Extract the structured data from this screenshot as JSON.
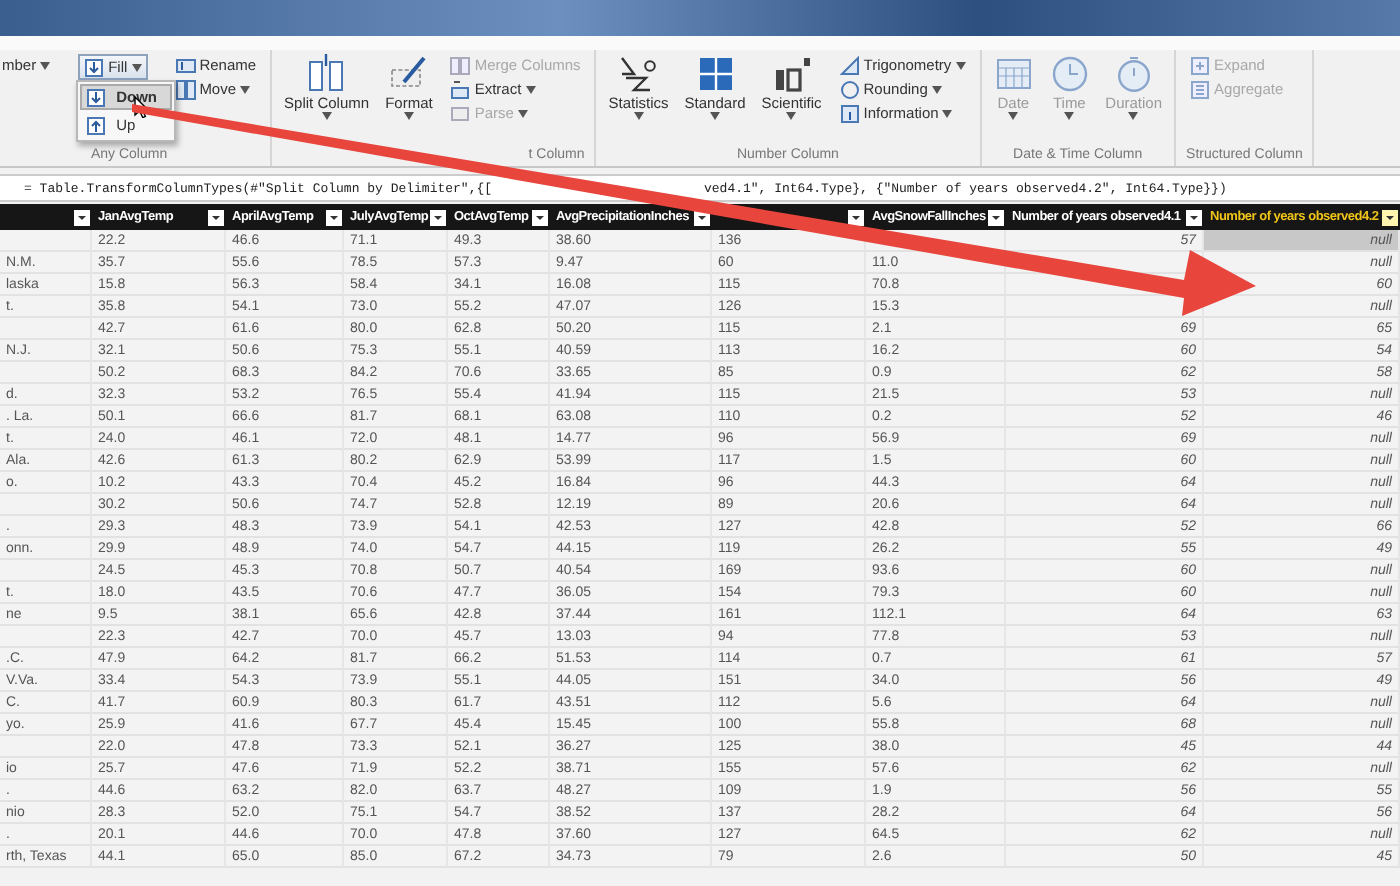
{
  "ribbon": {
    "groups": [
      {
        "label": "Any Column",
        "columns": [
          [
            {
              "kind": "small",
              "label": "mber",
              "dropdown": true,
              "disabled": false
            }
          ],
          [
            {
              "kind": "split",
              "label": "Fill",
              "dropdown": true,
              "disabled": false,
              "menu": [
                {
                  "label": "Down",
                  "selected": true
                },
                {
                  "label": "Up",
                  "selected": false
                }
              ]
            }
          ],
          [
            {
              "kind": "small",
              "label": "Rename",
              "dropdown": false,
              "disabled": false
            },
            {
              "kind": "small",
              "label": "Move",
              "dropdown": true,
              "disabled": false
            }
          ]
        ]
      },
      {
        "label": "t Column",
        "columns": [
          [
            {
              "kind": "large",
              "label": "Split Column",
              "dropdown": true,
              "disabled": false
            }
          ],
          [
            {
              "kind": "large",
              "label": "Format",
              "dropdown": true,
              "disabled": false
            }
          ],
          [
            {
              "kind": "small",
              "label": "Merge Columns",
              "dropdown": false,
              "disabled": true
            },
            {
              "kind": "small",
              "label": "Extract",
              "dropdown": true,
              "disabled": false
            },
            {
              "kind": "small",
              "label": "Parse",
              "dropdown": true,
              "disabled": true
            }
          ]
        ]
      },
      {
        "label": "Number Column",
        "columns": [
          [
            {
              "kind": "large",
              "label": "Statistics",
              "dropdown": true,
              "disabled": false
            }
          ],
          [
            {
              "kind": "large",
              "label": "Standard",
              "dropdown": true,
              "disabled": false
            }
          ],
          [
            {
              "kind": "large",
              "label": "Scientific",
              "dropdown": true,
              "disabled": false
            }
          ],
          [
            {
              "kind": "small",
              "label": "Trigonometry",
              "dropdown": true,
              "disabled": false
            },
            {
              "kind": "small",
              "label": "Rounding",
              "dropdown": true,
              "disabled": false
            },
            {
              "kind": "small",
              "label": "Information",
              "dropdown": true,
              "disabled": false
            }
          ]
        ]
      },
      {
        "label": "Date & Time Column",
        "columns": [
          [
            {
              "kind": "large",
              "label": "Date",
              "dropdown": true,
              "disabled": true
            }
          ],
          [
            {
              "kind": "large",
              "label": "Time",
              "dropdown": true,
              "disabled": true
            }
          ],
          [
            {
              "kind": "large",
              "label": "Duration",
              "dropdown": true,
              "disabled": true
            }
          ]
        ]
      },
      {
        "label": "Structured Column",
        "columns": [
          [
            {
              "kind": "small",
              "label": "Expand",
              "dropdown": false,
              "disabled": true
            },
            {
              "kind": "small",
              "label": "Aggregate",
              "dropdown": false,
              "disabled": true
            }
          ]
        ]
      }
    ]
  },
  "formula_bar": {
    "text_left": "= Table.TransformColumnTypes(#\"Split Column by Delimiter\",{[",
    "text_right": "ved4.1\", Int64.Type}, {\"Number of years observed4.2\", Int64.Type}})"
  },
  "table": {
    "columns": [
      {
        "kind": "text",
        "selected": false
      },
      {
        "label": "JanAvgTemp",
        "kind": "decimal",
        "selected": false
      },
      {
        "label": "AprilAvgTemp",
        "kind": "decimal",
        "selected": false
      },
      {
        "label": "JulyAvgTemp",
        "kind": "decimal",
        "selected": false
      },
      {
        "label": "OctAvgTemp",
        "kind": "decimal",
        "selected": false
      },
      {
        "label": "AvgPrecipitationInches",
        "kind": "decimal",
        "selected": false
      },
      {
        "kind": "decimal",
        "selected": false
      },
      {
        "label": "AvgSnowFallInches",
        "kind": "decimal",
        "selected": false
      },
      {
        "label": "Number of years observed4.1",
        "kind": "whole",
        "selected": false
      },
      {
        "label": "Number of years observed4.2",
        "kind": "whole",
        "selected": true
      }
    ],
    "rows": [
      {
        "selected": true,
        "cells": [
          null,
          "22.2",
          "46.6",
          "71.1",
          "49.3",
          "38.60",
          "136",
          null,
          "57",
          "null"
        ]
      },
      {
        "selected": false,
        "cells": [
          "N.M.",
          "35.7",
          "55.6",
          "78.5",
          "57.3",
          "9.47",
          "60",
          "11.0",
          null,
          "null"
        ]
      },
      {
        "selected": false,
        "cells": [
          "laska",
          "15.8",
          "56.3",
          "58.4",
          "34.1",
          "16.08",
          "115",
          "70.8",
          null,
          "60"
        ]
      },
      {
        "selected": false,
        "cells": [
          "t.",
          "35.8",
          "54.1",
          "73.0",
          "55.2",
          "47.07",
          "126",
          "15.3",
          null,
          "null"
        ]
      },
      {
        "selected": false,
        "cells": [
          null,
          "42.7",
          "61.6",
          "80.0",
          "62.8",
          "50.20",
          "115",
          "2.1",
          "69",
          "65"
        ]
      },
      {
        "selected": false,
        "cells": [
          "N.J.",
          "32.1",
          "50.6",
          "75.3",
          "55.1",
          "40.59",
          "113",
          "16.2",
          "60",
          "54"
        ]
      },
      {
        "selected": false,
        "cells": [
          null,
          "50.2",
          "68.3",
          "84.2",
          "70.6",
          "33.65",
          "85",
          "0.9",
          "62",
          "58"
        ]
      },
      {
        "selected": false,
        "cells": [
          "d.",
          "32.3",
          "53.2",
          "76.5",
          "55.4",
          "41.94",
          "115",
          "21.5",
          "53",
          "null"
        ]
      },
      {
        "selected": false,
        "cells": [
          ". La.",
          "50.1",
          "66.6",
          "81.7",
          "68.1",
          "63.08",
          "110",
          "0.2",
          "52",
          "46"
        ]
      },
      {
        "selected": false,
        "cells": [
          "t.",
          "24.0",
          "46.1",
          "72.0",
          "48.1",
          "14.77",
          "96",
          "56.9",
          "69",
          "null"
        ]
      },
      {
        "selected": false,
        "cells": [
          "Ala.",
          "42.6",
          "61.3",
          "80.2",
          "62.9",
          "53.99",
          "117",
          "1.5",
          "60",
          "null"
        ]
      },
      {
        "selected": false,
        "cells": [
          "o.",
          "10.2",
          "43.3",
          "70.4",
          "45.2",
          "16.84",
          "96",
          "44.3",
          "64",
          "null"
        ]
      },
      {
        "selected": false,
        "cells": [
          null,
          "30.2",
          "50.6",
          "74.7",
          "52.8",
          "12.19",
          "89",
          "20.6",
          "64",
          "null"
        ]
      },
      {
        "selected": false,
        "cells": [
          ".",
          "29.3",
          "48.3",
          "73.9",
          "54.1",
          "42.53",
          "127",
          "42.8",
          "52",
          "66"
        ]
      },
      {
        "selected": false,
        "cells": [
          "onn.",
          "29.9",
          "48.9",
          "74.0",
          "54.7",
          "44.15",
          "119",
          "26.2",
          "55",
          "49"
        ]
      },
      {
        "selected": false,
        "cells": [
          null,
          "24.5",
          "45.3",
          "70.8",
          "50.7",
          "40.54",
          "169",
          "93.6",
          "60",
          "null"
        ]
      },
      {
        "selected": false,
        "cells": [
          "t.",
          "18.0",
          "43.5",
          "70.6",
          "47.7",
          "36.05",
          "154",
          "79.3",
          "60",
          "null"
        ]
      },
      {
        "selected": false,
        "cells": [
          "ne",
          "9.5",
          "38.1",
          "65.6",
          "42.8",
          "37.44",
          "161",
          "112.1",
          "64",
          "63"
        ]
      },
      {
        "selected": false,
        "cells": [
          null,
          "22.3",
          "42.7",
          "70.0",
          "45.7",
          "13.03",
          "94",
          "77.8",
          "53",
          "null"
        ]
      },
      {
        "selected": false,
        "cells": [
          ".C.",
          "47.9",
          "64.2",
          "81.7",
          "66.2",
          "51.53",
          "114",
          "0.7",
          "61",
          "57"
        ]
      },
      {
        "selected": false,
        "cells": [
          "V.Va.",
          "33.4",
          "54.3",
          "73.9",
          "55.1",
          "44.05",
          "151",
          "34.0",
          "56",
          "49"
        ]
      },
      {
        "selected": false,
        "cells": [
          "C.",
          "41.7",
          "60.9",
          "80.3",
          "61.7",
          "43.51",
          "112",
          "5.6",
          "64",
          "null"
        ]
      },
      {
        "selected": false,
        "cells": [
          "yo.",
          "25.9",
          "41.6",
          "67.7",
          "45.4",
          "15.45",
          "100",
          "55.8",
          "68",
          "null"
        ]
      },
      {
        "selected": false,
        "cells": [
          null,
          "22.0",
          "47.8",
          "73.3",
          "52.1",
          "36.27",
          "125",
          "38.0",
          "45",
          "44"
        ]
      },
      {
        "selected": false,
        "cells": [
          "io",
          "25.7",
          "47.6",
          "71.9",
          "52.2",
          "38.71",
          "155",
          "57.6",
          "62",
          "null"
        ]
      },
      {
        "selected": false,
        "cells": [
          ".",
          "44.6",
          "63.2",
          "82.0",
          "63.7",
          "48.27",
          "109",
          "1.9",
          "56",
          "55"
        ]
      },
      {
        "selected": false,
        "cells": [
          "nio",
          "28.3",
          "52.0",
          "75.1",
          "54.7",
          "38.52",
          "137",
          "28.2",
          "64",
          "56"
        ]
      },
      {
        "selected": false,
        "cells": [
          ".",
          "20.1",
          "44.6",
          "70.0",
          "47.8",
          "37.60",
          "127",
          "64.5",
          "62",
          "null"
        ]
      },
      {
        "selected": false,
        "cells": [
          "rth, Texas",
          "44.1",
          "65.0",
          "85.0",
          "67.2",
          "34.73",
          "79",
          "2.6",
          "50",
          "45"
        ]
      }
    ]
  }
}
